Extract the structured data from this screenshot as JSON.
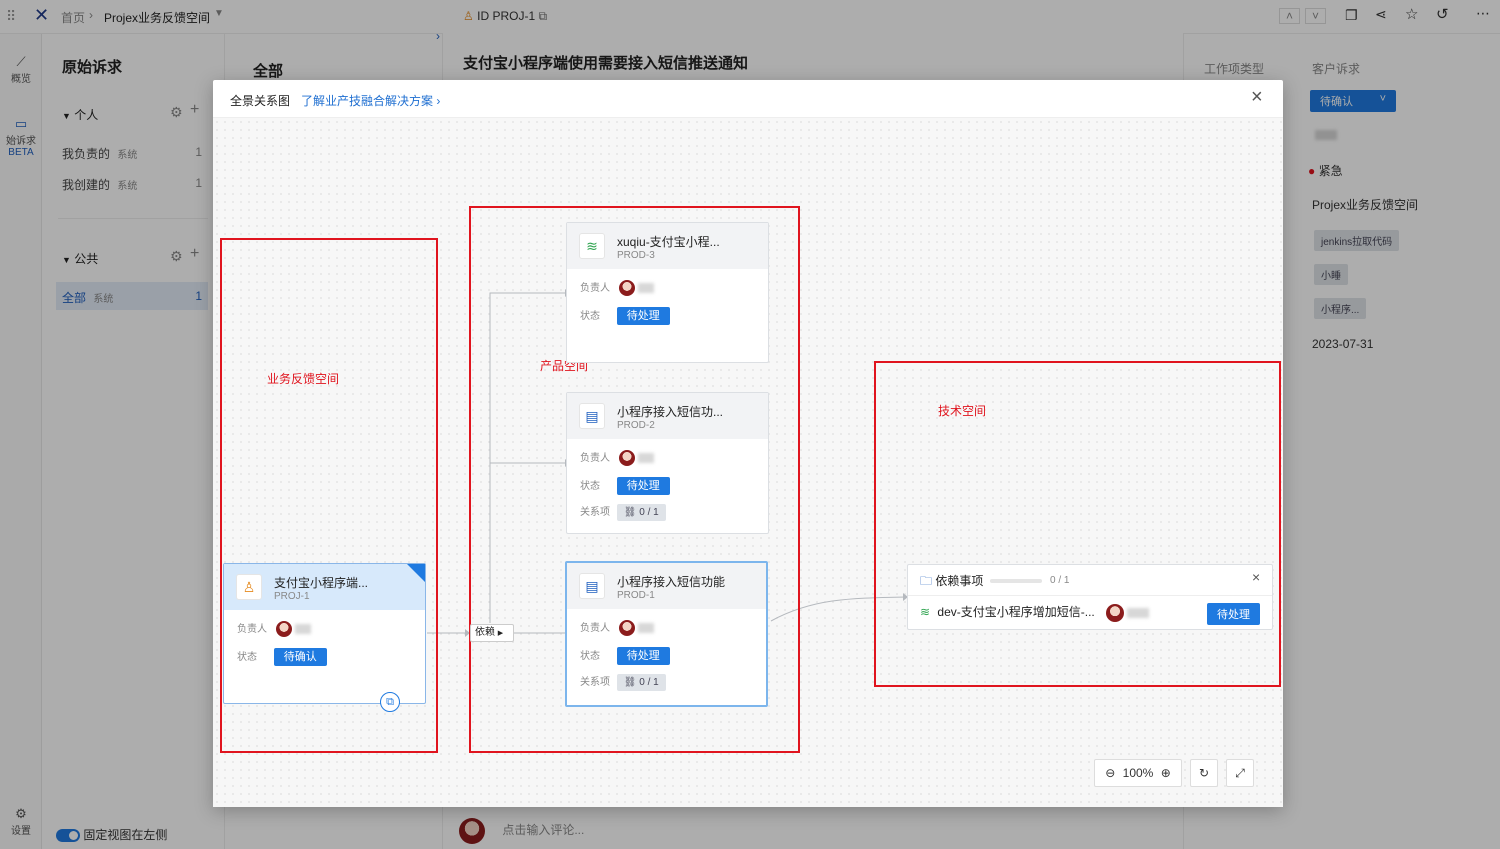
{
  "topbar": {
    "home": "首页",
    "space": "Projex业务反馈空间"
  },
  "rail": {
    "overview": "概览",
    "requests": "始诉求",
    "beta": "BETA",
    "settings": "设置"
  },
  "leftpanel": {
    "title": "原始诉求",
    "personal": "个人",
    "items": [
      {
        "label": "我负责的",
        "tag": "系统",
        "count": "1"
      },
      {
        "label": "我创建的",
        "tag": "系统",
        "count": "1"
      }
    ],
    "public": "公共",
    "public_item": {
      "label": "全部",
      "tag": "系统",
      "count": "1"
    },
    "pin_label": "固定视图在左侧"
  },
  "listpanel": {
    "title": "全部"
  },
  "detail": {
    "id": "ID PROJ-1",
    "title": "支付宝小程序端使用需要接入短信推送通知",
    "comment_placeholder": "点击输入评论..."
  },
  "rightpanel": {
    "type_label": "工作项类型",
    "customer_label": "客户诉求",
    "status": "待确认",
    "priority": "紧急",
    "space": "Projex业务反馈空间",
    "tags": [
      "jenkins拉取代码",
      "小睡",
      "小程序..."
    ],
    "date": "2023-07-31"
  },
  "modal": {
    "title": "全景关系图",
    "link": "了解业产技融合解决方案",
    "zones": {
      "business": "业务反馈空间",
      "product": "产品空间",
      "tech": "技术空间"
    },
    "owner_label": "负责人",
    "status_label": "状态",
    "relation_label": "关系项",
    "edge_label": "依赖",
    "cards": [
      {
        "title": "xuqiu-支付宝小程...",
        "id": "PROD-3",
        "status": "待处理"
      },
      {
        "title": "小程序接入短信功...",
        "id": "PROD-2",
        "status": "待处理",
        "relation": "0 / 1"
      },
      {
        "title": "小程序接入短信功能",
        "id": "PROD-1",
        "status": "待处理",
        "relation": "0 / 1"
      },
      {
        "title": "支付宝小程序端...",
        "id": "PROJ-1",
        "status": "待确认"
      }
    ],
    "dep": {
      "title": "依赖事项",
      "count": "0 / 1",
      "item": "dev-支付宝小程序增加短信-...",
      "status": "待处理"
    },
    "zoom": "100%"
  }
}
